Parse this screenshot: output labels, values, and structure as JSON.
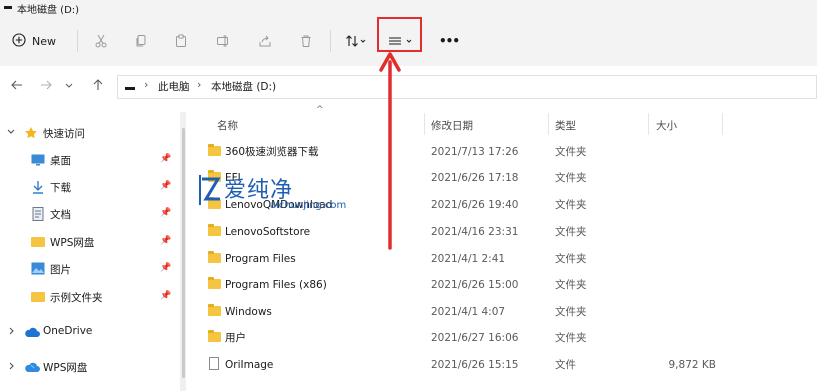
{
  "window": {
    "title": "本地磁盘 (D:)"
  },
  "toolbar": {
    "new_label": "New",
    "buttons": [
      "cut-icon",
      "copy-icon",
      "paste-icon",
      "rename-icon",
      "share-icon",
      "delete-icon",
      "sort-icon",
      "view-icon",
      "more-icon"
    ],
    "more_label": "•••"
  },
  "address": {
    "crumbs": [
      "此电脑",
      "本地磁盘 (D:)"
    ]
  },
  "sidebar": {
    "quick_access": "快速访问",
    "items": [
      {
        "label": "桌面",
        "icon": "desktop-icon",
        "pinned": true
      },
      {
        "label": "下载",
        "icon": "download-icon",
        "pinned": true
      },
      {
        "label": "文档",
        "icon": "document-icon",
        "pinned": true
      },
      {
        "label": "WPS网盘",
        "icon": "folder-icon",
        "pinned": true
      },
      {
        "label": "图片",
        "icon": "pictures-icon",
        "pinned": true
      },
      {
        "label": "示例文件夹",
        "icon": "folder-icon",
        "pinned": true
      }
    ],
    "onedrive": "OneDrive",
    "wps": "WPS网盘"
  },
  "columns": {
    "name": "名称",
    "date": "修改日期",
    "type": "类型",
    "size": "大小"
  },
  "files": [
    {
      "name": "360极速浏览器下载",
      "date": "2021/7/13 17:26",
      "type": "文件夹",
      "size": "",
      "kind": "folder"
    },
    {
      "name": "EFI",
      "date": "2021/6/26 17:18",
      "type": "文件夹",
      "size": "",
      "kind": "folder"
    },
    {
      "name": "LenovoQMDownload",
      "date": "2021/6/26 19:40",
      "type": "文件夹",
      "size": "",
      "kind": "folder"
    },
    {
      "name": "LenovoSoftstore",
      "date": "2021/4/16 23:31",
      "type": "文件夹",
      "size": "",
      "kind": "folder"
    },
    {
      "name": "Program Files",
      "date": "2021/4/1 2:41",
      "type": "文件夹",
      "size": "",
      "kind": "folder"
    },
    {
      "name": "Program Files (x86)",
      "date": "2021/6/26 15:00",
      "type": "文件夹",
      "size": "",
      "kind": "folder"
    },
    {
      "name": "Windows",
      "date": "2021/4/1 4:07",
      "type": "文件夹",
      "size": "",
      "kind": "folder"
    },
    {
      "name": "用户",
      "date": "2021/6/27 16:06",
      "type": "文件夹",
      "size": "",
      "kind": "folder"
    },
    {
      "name": "OriImage",
      "date": "2021/6/26 15:15",
      "type": "文件",
      "size": "9,872 KB",
      "kind": "file"
    }
  ],
  "watermark": {
    "text": "爱纯净",
    "url": "aichunjing.com"
  },
  "colors": {
    "highlight": "#e22d2d",
    "folder": "#f5c542",
    "watermark": "#1e5fb3"
  }
}
